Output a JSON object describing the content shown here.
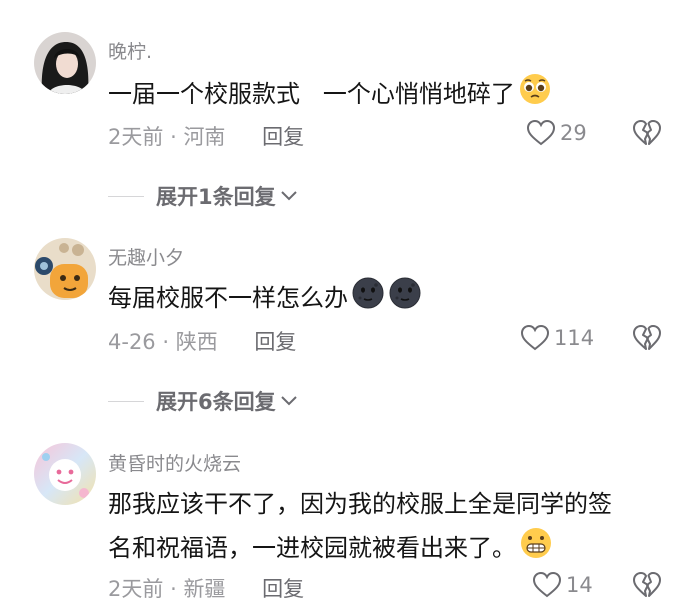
{
  "colors": {
    "username": "#8a8a8e",
    "text": "#151515",
    "meta": "#9a9a9e",
    "reply": "#6b6b70"
  },
  "comments": [
    {
      "username": "晚柠.",
      "text": "一届一个校服款式   一个心悄悄地碎了",
      "emojis": [
        "pleading-face"
      ],
      "time": "2天前",
      "location": "河南",
      "reply_label": "回复",
      "likes": "29",
      "expand_label": "展开1条回复"
    },
    {
      "username": "无趣小夕",
      "text": "每届校服不一样怎么办",
      "emojis": [
        "new-moon-face",
        "new-moon-face"
      ],
      "time": "4-26",
      "location": "陕西",
      "reply_label": "回复",
      "likes": "114",
      "expand_label": "展开6条回复"
    },
    {
      "username": "黄昏时的火烧云",
      "text_lines": [
        "那我应该干不了，因为我的校服上全是同学的签",
        "名和祝福语，一进校园就被看出来了。"
      ],
      "emojis": [
        "grimacing-face"
      ],
      "time": "2天前",
      "location": "新疆",
      "reply_label": "回复",
      "likes": "14"
    }
  ]
}
